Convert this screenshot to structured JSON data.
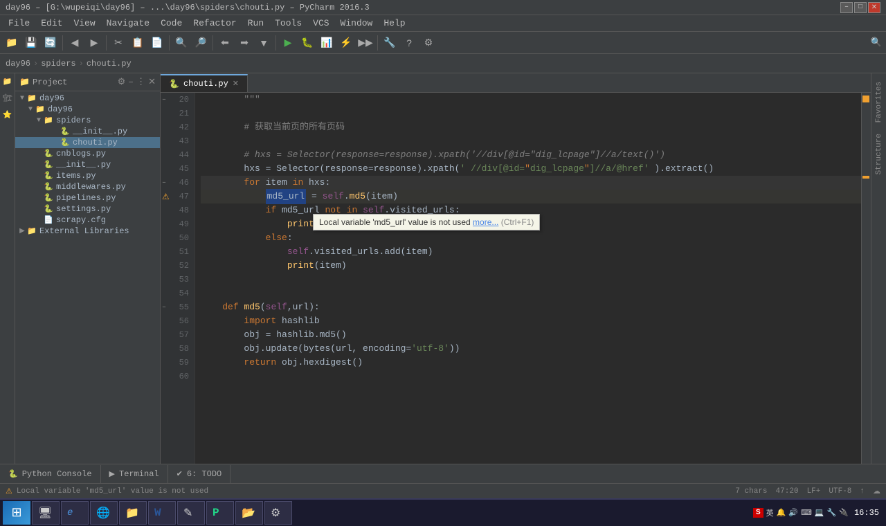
{
  "titlebar": {
    "title": "day96 – [G:\\wupeiqi\\day96] – ...\\day96\\spiders\\chouti.py – PyCharm 2016.3",
    "minimize": "–",
    "maximize": "□",
    "close": "✕"
  },
  "menu": {
    "items": [
      "File",
      "Edit",
      "View",
      "Navigate",
      "Code",
      "Refactor",
      "Run",
      "Tools",
      "VCS",
      "Window",
      "Help"
    ]
  },
  "breadcrumb": {
    "items": [
      "day96",
      "spiders",
      "chouti.py"
    ]
  },
  "project": {
    "title": "Project",
    "root": "day96",
    "rootPath": "G:\\wupeiqi\\day96",
    "tree": [
      {
        "label": "day96",
        "type": "folder",
        "level": 0,
        "expanded": true
      },
      {
        "label": "day96",
        "type": "folder",
        "level": 1,
        "expanded": true
      },
      {
        "label": "spiders",
        "type": "folder",
        "level": 2,
        "expanded": true
      },
      {
        "label": "__init__.py",
        "type": "py",
        "level": 3
      },
      {
        "label": "chouti.py",
        "type": "py",
        "level": 3,
        "selected": true
      },
      {
        "label": "cnblogs.py",
        "type": "py",
        "level": 2
      },
      {
        "label": "__init__.py",
        "type": "py",
        "level": 2
      },
      {
        "label": "items.py",
        "type": "py",
        "level": 2
      },
      {
        "label": "middlewares.py",
        "type": "py",
        "level": 2
      },
      {
        "label": "pipelines.py",
        "type": "py",
        "level": 2
      },
      {
        "label": "settings.py",
        "type": "py",
        "level": 2
      },
      {
        "label": "scrapy.cfg",
        "type": "cfg",
        "level": 2
      },
      {
        "label": "External Libraries",
        "type": "folder",
        "level": 0,
        "expanded": false
      }
    ]
  },
  "editor": {
    "tab": "chouti.py",
    "lines": [
      {
        "num": 20,
        "code": "        \"\"\""
      },
      {
        "num": 21,
        "code": ""
      },
      {
        "num": 42,
        "code": "        # 获取当前页的所有页码"
      },
      {
        "num": 43,
        "code": ""
      },
      {
        "num": 44,
        "code": "        # hxs = Selector(response=response).xpath('//div[@id=\"dig_lcpage\"]//a/text()')"
      },
      {
        "num": 45,
        "code": "        hxs = Selector(response=response).xpath(' //div[@id=\"dig_lcpage\"]//a/@href' ).extract()"
      },
      {
        "num": 46,
        "code": "        for item in hxs:"
      },
      {
        "num": 47,
        "code": "            md5_url = self.md5(item)"
      },
      {
        "num": 48,
        "code": "            if md5_url not in self.visited_urls:"
      },
      {
        "num": 49,
        "code": "                print('已经存在' ,item)"
      },
      {
        "num": 50,
        "code": "            else:"
      },
      {
        "num": 51,
        "code": "                self.visited_urls.add(item)"
      },
      {
        "num": 52,
        "code": "                print(item)"
      },
      {
        "num": 53,
        "code": ""
      },
      {
        "num": 54,
        "code": ""
      },
      {
        "num": 55,
        "code": "    def md5(self,url):"
      },
      {
        "num": 56,
        "code": "        import hashlib"
      },
      {
        "num": 57,
        "code": "        obj = hashlib.md5()"
      },
      {
        "num": 58,
        "code": "        obj.update(bytes(url, encoding='utf-8'))"
      },
      {
        "num": 59,
        "code": "        return obj.hexdigest()"
      },
      {
        "num": 60,
        "code": ""
      }
    ]
  },
  "tooltip": {
    "text": "Local variable 'md5_url' value is not used",
    "more": "more...",
    "shortcut": "(Ctrl+F1)"
  },
  "bottom_tabs": [
    {
      "label": "Python Console",
      "icon": "🐍",
      "active": false
    },
    {
      "label": "Terminal",
      "icon": "▶",
      "active": false
    },
    {
      "label": "6: TODO",
      "icon": "✔",
      "active": false
    }
  ],
  "status_bar": {
    "warning": "Local variable 'md5_url' value is not used",
    "chars": "7 chars",
    "position": "47:20",
    "lf": "LF+",
    "encoding": "UTF-8",
    "info1": "↑",
    "info2": "☁"
  },
  "taskbar": {
    "start_icon": "⊞",
    "apps": [
      {
        "icon": "🖥",
        "label": ""
      },
      {
        "icon": "e",
        "label": ""
      },
      {
        "icon": "🌐",
        "label": ""
      },
      {
        "icon": "📁",
        "label": ""
      },
      {
        "icon": "W",
        "label": ""
      },
      {
        "icon": "✎",
        "label": ""
      },
      {
        "icon": "A",
        "label": ""
      },
      {
        "icon": "📂",
        "label": ""
      },
      {
        "icon": "⚙",
        "label": ""
      }
    ],
    "time": "16:35",
    "date": ""
  },
  "colors": {
    "accent": "#6fa8dc",
    "warning": "#f0a030",
    "keyword": "#cc7832",
    "string": "#6a8759",
    "comment": "#808080",
    "self": "#94558d"
  }
}
